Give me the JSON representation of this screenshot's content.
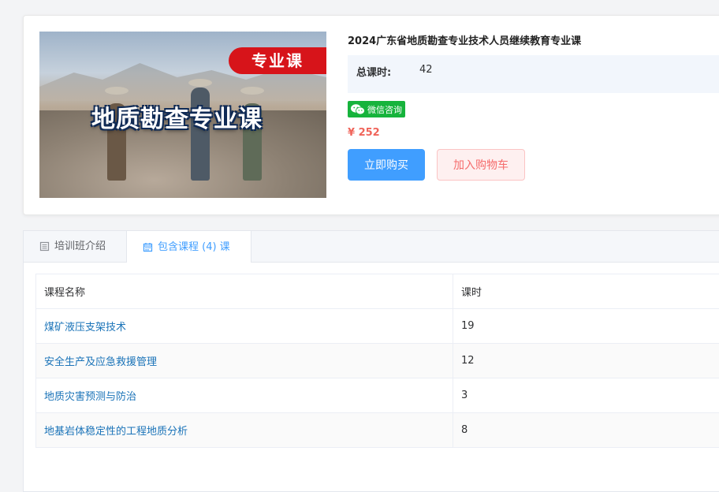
{
  "course": {
    "cover_ribbon": "专业课",
    "cover_title": "地质勘查专业课",
    "title": "2024广东省地质勘查专业技术人员继续教育专业课",
    "hours_label": "总课时:",
    "hours_value": "42",
    "wechat_label": "微信咨询",
    "wechat_icon": "wechat-icon",
    "price": "¥ 252",
    "buy_label": "立即购买",
    "cart_label": "加入购物车"
  },
  "colors": {
    "primary": "#409eff",
    "price": "#f0645a",
    "wechat": "#16b33c",
    "cart_text": "#f56c6c",
    "ribbon": "#d7141a"
  },
  "tabs": [
    {
      "label": "培训班介绍",
      "icon": "document-icon",
      "active": false
    },
    {
      "label": "包含课程 (4) 课",
      "icon": "calendar-icon",
      "active": true
    }
  ],
  "table": {
    "headers": [
      "课程名称",
      "课时"
    ],
    "rows": [
      {
        "name": "煤矿液压支架技术",
        "hours": "19"
      },
      {
        "name": "安全生产及应急救援管理",
        "hours": "12"
      },
      {
        "name": "地质灾害预测与防治",
        "hours": "3"
      },
      {
        "name": "地基岩体稳定性的工程地质分析",
        "hours": "8"
      }
    ]
  }
}
